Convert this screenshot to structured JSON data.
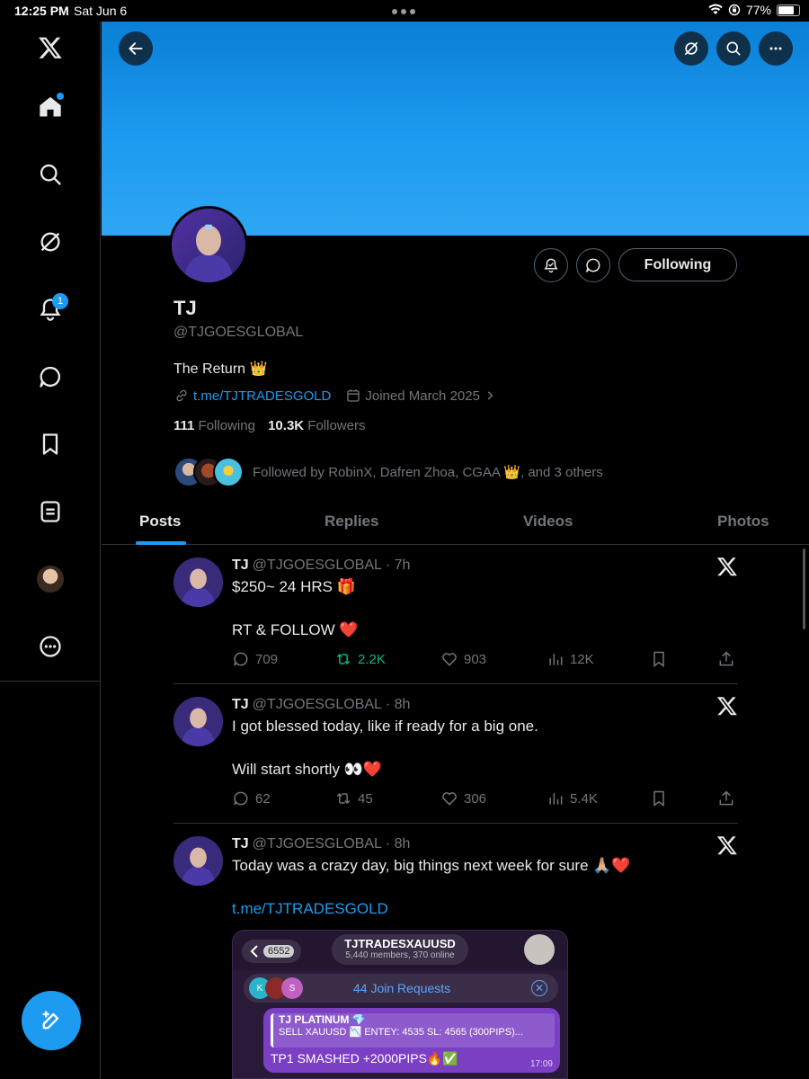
{
  "status_bar": {
    "time": "12:25 PM",
    "date": "Sat Jun 6",
    "battery": "77%"
  },
  "sidebar": {
    "notifications_badge": "1",
    "items": [
      "x-logo",
      "home",
      "explore",
      "grok",
      "notifications",
      "messages",
      "bookmarks",
      "lists",
      "profile",
      "more"
    ]
  },
  "profile": {
    "name": "TJ",
    "handle": "@TJGOESGLOBAL",
    "bio": "The Return 👑",
    "link": "t.me/TJTRADESGOLD",
    "joined": "Joined March 2025",
    "following_count": "111",
    "following_label": "Following",
    "followers_count": "10.3K",
    "followers_label": "Followers",
    "followed_by": "Followed by RobinX, Dafren Zhoa, CGAA 👑, and 3 others",
    "follow_button": "Following"
  },
  "tabs": [
    "Posts",
    "Replies",
    "Videos",
    "Photos"
  ],
  "tweets": [
    {
      "name": "TJ",
      "handle": "@TJGOESGLOBAL",
      "time": "· 7h",
      "line1": "$250~ 24 HRS 🎁",
      "line2": "RT & FOLLOW ❤️",
      "replies": "709",
      "retweets": "2.2K",
      "likes": "903",
      "views": "12K"
    },
    {
      "name": "TJ",
      "handle": "@TJGOESGLOBAL",
      "time": "· 8h",
      "line1": "I got blessed today, like if ready for a big one.",
      "line2": "Will start shortly 👀❤️",
      "replies": "62",
      "retweets": "45",
      "likes": "306",
      "views": "5.4K"
    },
    {
      "name": "TJ",
      "handle": "@TJGOESGLOBAL",
      "time": "· 8h",
      "line1": "Today was a crazy day, big things next week for sure 🙏🏼❤️",
      "link": "t.me/TJTRADESGOLD"
    }
  ],
  "embed": {
    "back_count": "6552",
    "channel": "TJTRADESXAUUSD",
    "members": "5,440 members, 370 online",
    "join_requests": "44 Join Requests",
    "mini_k": "K",
    "mini_s": "S",
    "quote_title": "TJ PLATINUM 💎",
    "quote_text": "SELL XAUUSD 📉 ENTEY: 4535 SL: 4565 (300PIPS)...",
    "message": "TP1 SMASHED +2000PIPS🔥✅",
    "msg_time": "17:09"
  }
}
